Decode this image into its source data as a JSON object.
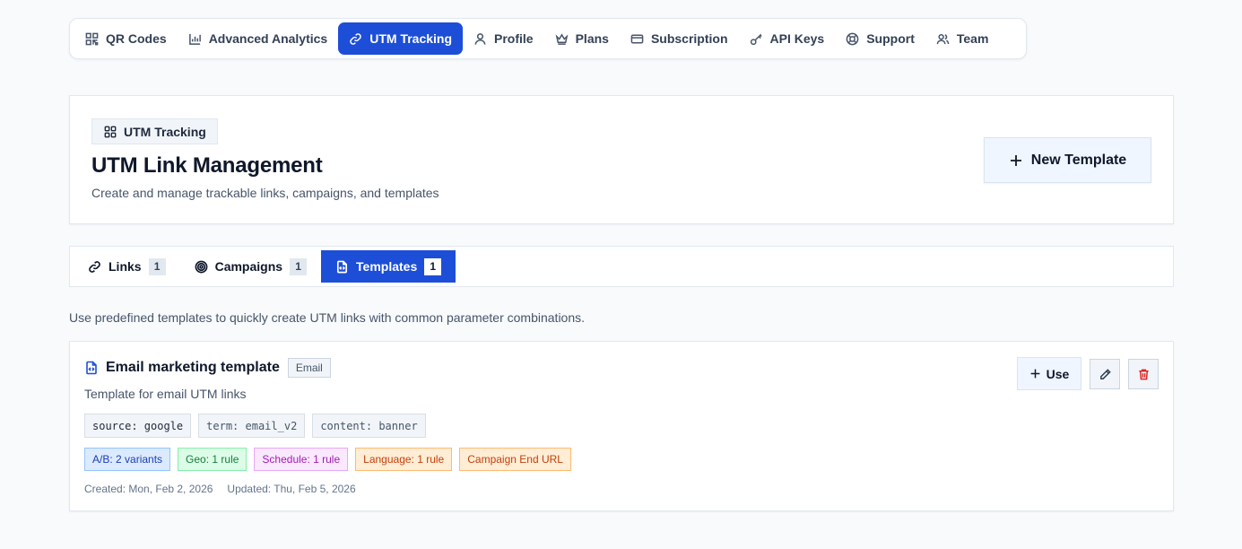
{
  "nav": {
    "items": [
      {
        "label": "QR Codes",
        "icon": "qr-code-icon",
        "active": false
      },
      {
        "label": "Advanced Analytics",
        "icon": "bar-chart-icon",
        "active": false
      },
      {
        "label": "UTM Tracking",
        "icon": "link-icon",
        "active": true
      },
      {
        "label": "Profile",
        "icon": "user-icon",
        "active": false
      },
      {
        "label": "Plans",
        "icon": "crown-icon",
        "active": false
      },
      {
        "label": "Subscription",
        "icon": "credit-card-icon",
        "active": false
      },
      {
        "label": "API Keys",
        "icon": "key-icon",
        "active": false
      },
      {
        "label": "Support",
        "icon": "lifebuoy-icon",
        "active": false
      },
      {
        "label": "Team",
        "icon": "users-icon",
        "active": false
      }
    ]
  },
  "header": {
    "badge": "UTM Tracking",
    "title": "UTM Link Management",
    "subtitle": "Create and manage trackable links, campaigns, and templates",
    "new_template_label": "New Template"
  },
  "tabs": [
    {
      "label": "Links",
      "count": "1",
      "icon": "link-icon",
      "active": false
    },
    {
      "label": "Campaigns",
      "count": "1",
      "icon": "target-icon",
      "active": false
    },
    {
      "label": "Templates",
      "count": "1",
      "icon": "file-code-icon",
      "active": true
    }
  ],
  "templates_section": {
    "description": "Use predefined templates to quickly create UTM links with common parameter combinations."
  },
  "template": {
    "name": "Email marketing template",
    "category": "Email",
    "description": "Template for email UTM links",
    "params": [
      "source: google",
      "term: email_v2",
      "content: banner"
    ],
    "rules": {
      "ab": "A/B: 2 variants",
      "geo": "Geo: 1 rule",
      "schedule": "Schedule: 1 rule",
      "language": "Language: 1 rule",
      "end_url": "Campaign End URL"
    },
    "created": "Created: Mon, Feb 2, 2026",
    "updated": "Updated: Thu, Feb 5, 2026",
    "use_label": "Use"
  },
  "colors": {
    "primary": "#1d4ed8",
    "danger": "#dc2626"
  }
}
